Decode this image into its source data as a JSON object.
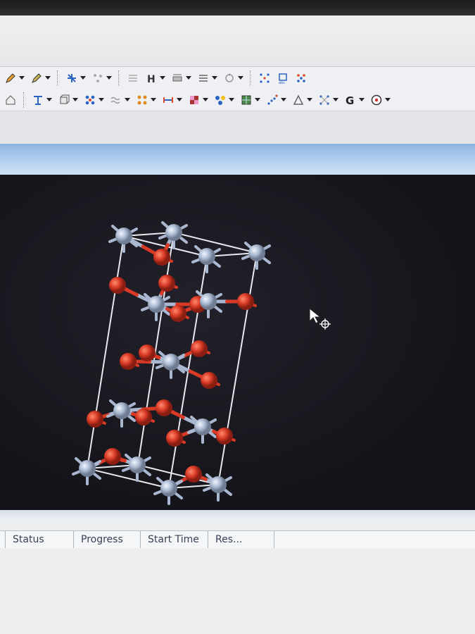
{
  "toolbar_row1": [
    {
      "icon": "pencil-orange-icon",
      "dropdown": true
    },
    {
      "icon": "pencil-green-icon",
      "dropdown": true
    },
    {
      "sep": true
    },
    {
      "icon": "bond-tool-icon",
      "dropdown": true
    },
    {
      "icon": "molecule-grey-icon",
      "dropdown": true
    },
    {
      "sep": true
    },
    {
      "icon": "grid-grey-icon",
      "dropdown": false
    },
    {
      "icon": "hydrogen-icon",
      "dropdown": true
    },
    {
      "icon": "slab-icon",
      "dropdown": true
    },
    {
      "icon": "layers-icon",
      "dropdown": true
    },
    {
      "icon": "ring-icon",
      "dropdown": true
    },
    {
      "sep": true
    },
    {
      "icon": "lattice-icon",
      "dropdown": false
    },
    {
      "icon": "cube-abc-icon",
      "dropdown": false
    },
    {
      "icon": "cluster-icon",
      "dropdown": false
    }
  ],
  "toolbar_row2": [
    {
      "icon": "home-icon",
      "dropdown": false
    },
    {
      "sep": true
    },
    {
      "icon": "axis-icon",
      "dropdown": true
    },
    {
      "icon": "cell-icon",
      "dropdown": true
    },
    {
      "icon": "atoms-blue-icon",
      "dropdown": true
    },
    {
      "icon": "wave-icon",
      "dropdown": true
    },
    {
      "icon": "atoms-orange-icon",
      "dropdown": true
    },
    {
      "icon": "measure-icon",
      "dropdown": true
    },
    {
      "icon": "checker-icon",
      "dropdown": true
    },
    {
      "icon": "color-atoms-icon",
      "dropdown": true
    },
    {
      "icon": "map-icon",
      "dropdown": true
    },
    {
      "icon": "scatter-icon",
      "dropdown": true
    },
    {
      "icon": "angle-icon",
      "dropdown": true
    },
    {
      "icon": "symmetry-icon",
      "dropdown": true
    },
    {
      "icon": "g-icon",
      "dropdown": true
    },
    {
      "icon": "target-icon",
      "dropdown": true
    }
  ],
  "viewport": {
    "cursor_icon": "rotate-cursor-icon",
    "structure_icon": "crystal-structure",
    "colors": {
      "metal": "#a9b8d0",
      "oxygen": "#d93a26",
      "bond": "#e8eaf0",
      "background": "#17161c"
    }
  },
  "jobs_panel": {
    "columns": [
      "Status",
      "Progress",
      "Start Time",
      "Res..."
    ]
  },
  "colors": {
    "header_blue": "#a9c8ea",
    "toolbar_bg": "#eef0f3",
    "panel_bg": "#eceef0"
  }
}
